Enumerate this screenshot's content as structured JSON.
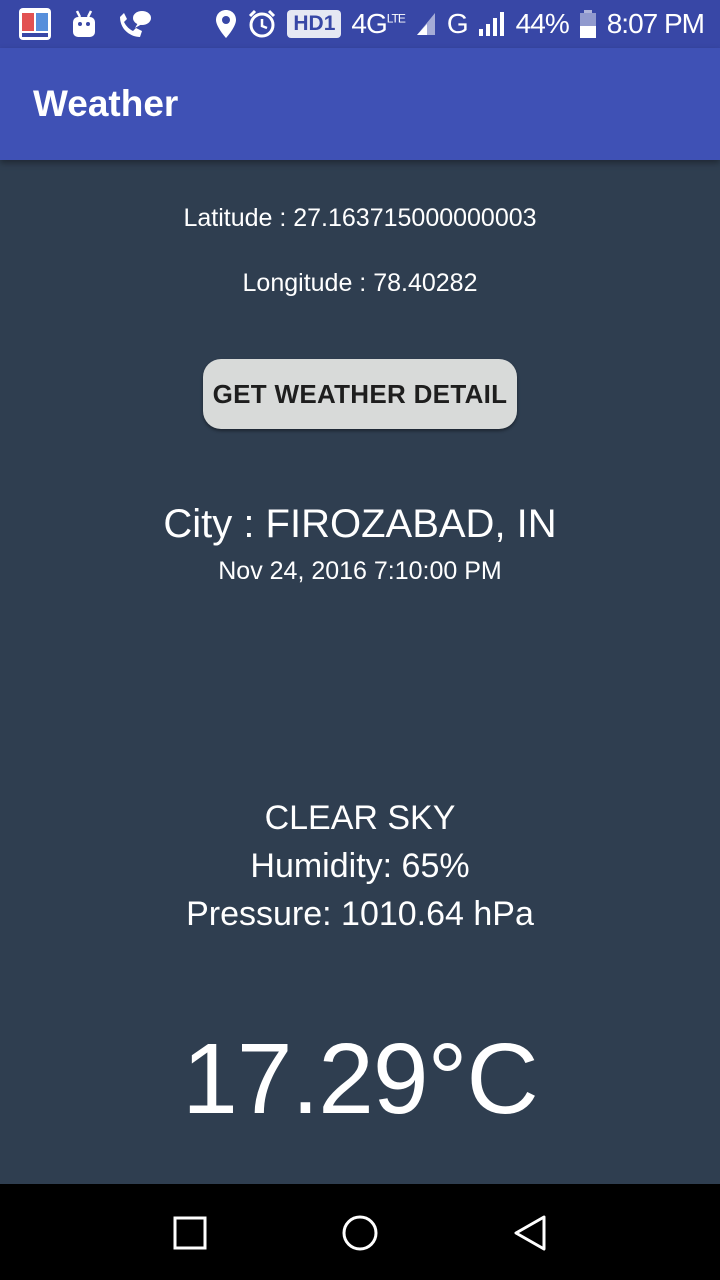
{
  "status_bar": {
    "network_badge": "HD1",
    "network_type": "4G",
    "network_sub": "LTE",
    "g_label": "G",
    "battery": "44%",
    "time": "8:07 PM",
    "icons": [
      "app-icon",
      "android-icon",
      "phone-chat-icon",
      "location-icon",
      "alarm-icon",
      "signal-icon",
      "battery-icon"
    ]
  },
  "app_bar": {
    "title": "Weather"
  },
  "location": {
    "latitude": "Latitude : 27.163715000000003",
    "longitude": "Longitude : 78.40282"
  },
  "button": {
    "label": "GET WEATHER DETAIL"
  },
  "weather": {
    "city": "City : FIROZABAD, IN",
    "datetime": "Nov 24, 2016 7:10:00 PM",
    "condition": "CLEAR SKY",
    "humidity": "Humidity: 65%",
    "pressure": "Pressure: 1010.64 hPa",
    "temperature": "17.29°C"
  },
  "nav_bar": {
    "icons": [
      "recents-icon",
      "home-icon",
      "back-icon"
    ]
  },
  "colors": {
    "status_bar": "#3847a6",
    "app_bar": "#3f51b5",
    "background": "#2f3e50",
    "button": "#d8dad9"
  }
}
